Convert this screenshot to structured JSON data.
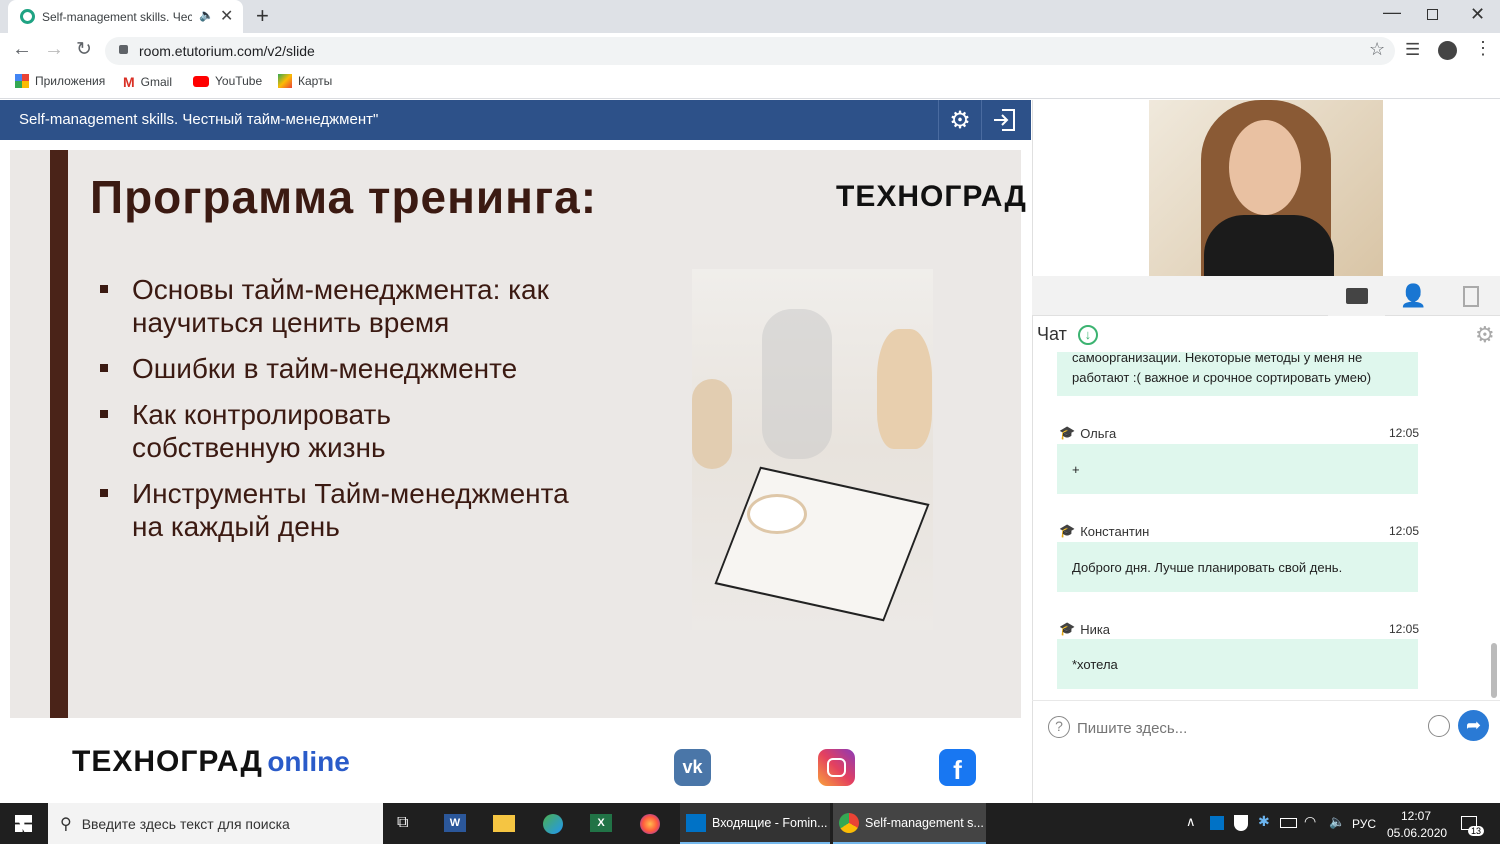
{
  "browser": {
    "tab_title": "Self-management skills. Чест",
    "url": "room.etutorium.com/v2/slide",
    "bookmarks": [
      {
        "label": "Приложения"
      },
      {
        "label": "Gmail"
      },
      {
        "label": "YouTube"
      },
      {
        "label": "Карты"
      }
    ]
  },
  "app": {
    "title": "Self-management skills. Честный тайм-менеджмент\""
  },
  "slide": {
    "title": "Программа тренинга:",
    "logo": "ТЕХНОГРАД",
    "bullets": [
      {
        "text": "Основы тайм-менеджмента: как научиться ценить время"
      },
      {
        "text": "Ошибки в тайм-менеджменте"
      },
      {
        "text": "Как контролировать собственную жизнь"
      },
      {
        "text": "Инструменты Тайм-менеджмента на каждый день"
      }
    ],
    "footer_logo": "ТЕХНОГРАД",
    "footer_logo_suffix": "online"
  },
  "chat": {
    "header": "Чат",
    "partial_message": {
      "line1": "самоорганизации. Некоторые методы у меня не",
      "line2": "работают :( важное и срочное сортировать умею)"
    },
    "messages": [
      {
        "author": "Ольга",
        "time": "12:05",
        "text": "+"
      },
      {
        "author": "Константин",
        "time": "12:05",
        "text": "Доброго дня. Лучше планировать свой день."
      },
      {
        "author": "Ника",
        "time": "12:05",
        "text": "*хотела"
      }
    ],
    "input_placeholder": "Пишите здесь..."
  },
  "taskbar": {
    "search_placeholder": "Введите здесь текст для поиска",
    "apps": [
      {
        "label": "Входящие - Fomin..."
      },
      {
        "label": "Self-management s..."
      }
    ],
    "tray": {
      "lang": "РУС",
      "time": "12:07",
      "date": "05.06.2020",
      "notifications": "13"
    }
  },
  "colors": {
    "appbar": "#2d5189",
    "slide_text": "#3b1a12",
    "chat_bubble": "#dff7ed",
    "accent_blue": "#2a7ad5"
  }
}
